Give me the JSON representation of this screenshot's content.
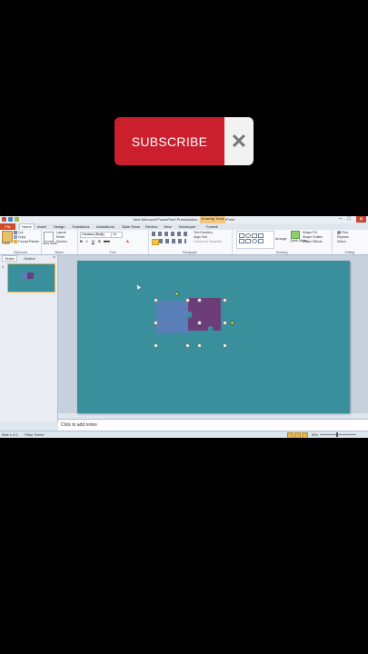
{
  "banner": {
    "subscribe_label": "SUBSCRIBE",
    "close_glyph": "✕"
  },
  "window": {
    "title": "New Microsoft PowerPoint Presentation - Microsoft PowerPoint",
    "context_tab": "Drawing Tools",
    "controls": [
      "–",
      "□",
      "✕"
    ]
  },
  "ribbon": {
    "tabs": [
      "File",
      "Home",
      "Insert",
      "Design",
      "Transitions",
      "Animations",
      "Slide Show",
      "Review",
      "View",
      "Developer",
      "Format"
    ],
    "active_tab": "Home",
    "clipboard": {
      "paste": "Paste",
      "cut": "Cut",
      "copy": "Copy",
      "format_painter": "Format Painter",
      "group": "Clipboard"
    },
    "slides": {
      "new_slide": "New Slide",
      "layout": "Layout",
      "reset": "Reset",
      "section": "Section",
      "group": "Slides"
    },
    "font": {
      "name": "Candara (Body)",
      "size": "14",
      "group": "Font"
    },
    "paragraph": {
      "text_direction": "Text Direction",
      "align_text": "Align Text",
      "smartart": "Convert to SmartArt",
      "group": "Paragraph"
    },
    "drawing": {
      "arrange": "Arrange",
      "quick_styles": "Quick Styles",
      "shape_fill": "Shape Fill",
      "shape_outline": "Shape Outline",
      "shape_effects": "Shape Effects",
      "group": "Drawing"
    },
    "editing": {
      "find": "Find",
      "replace": "Replace",
      "select": "Select",
      "group": "Editing"
    }
  },
  "leftpane": {
    "tabs": [
      "Slides",
      "Outline"
    ],
    "active_tab": "Slides",
    "slide_number": "1",
    "close": "×"
  },
  "slide": {
    "background": "#3a8f9c",
    "piece_colors": {
      "blue": "#5b7fb8",
      "purple": "#6b3e7a"
    }
  },
  "notes": {
    "placeholder": "Click to add notes"
  },
  "status": {
    "slide_info": "Slide 1 of 1",
    "theme": "\"Office Theme\"",
    "zoom": "80%"
  }
}
